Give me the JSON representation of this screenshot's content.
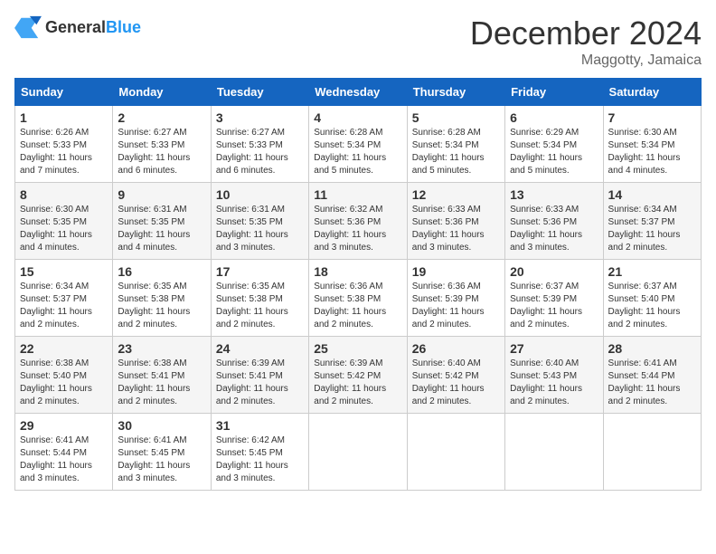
{
  "header": {
    "logo_general": "General",
    "logo_blue": "Blue",
    "month": "December 2024",
    "location": "Maggotty, Jamaica"
  },
  "weekdays": [
    "Sunday",
    "Monday",
    "Tuesday",
    "Wednesday",
    "Thursday",
    "Friday",
    "Saturday"
  ],
  "weeks": [
    [
      {
        "day": "1",
        "sunrise": "6:26 AM",
        "sunset": "5:33 PM",
        "daylight": "11 hours and 7 minutes."
      },
      {
        "day": "2",
        "sunrise": "6:27 AM",
        "sunset": "5:33 PM",
        "daylight": "11 hours and 6 minutes."
      },
      {
        "day": "3",
        "sunrise": "6:27 AM",
        "sunset": "5:33 PM",
        "daylight": "11 hours and 6 minutes."
      },
      {
        "day": "4",
        "sunrise": "6:28 AM",
        "sunset": "5:34 PM",
        "daylight": "11 hours and 5 minutes."
      },
      {
        "day": "5",
        "sunrise": "6:28 AM",
        "sunset": "5:34 PM",
        "daylight": "11 hours and 5 minutes."
      },
      {
        "day": "6",
        "sunrise": "6:29 AM",
        "sunset": "5:34 PM",
        "daylight": "11 hours and 5 minutes."
      },
      {
        "day": "7",
        "sunrise": "6:30 AM",
        "sunset": "5:34 PM",
        "daylight": "11 hours and 4 minutes."
      }
    ],
    [
      {
        "day": "8",
        "sunrise": "6:30 AM",
        "sunset": "5:35 PM",
        "daylight": "11 hours and 4 minutes."
      },
      {
        "day": "9",
        "sunrise": "6:31 AM",
        "sunset": "5:35 PM",
        "daylight": "11 hours and 4 minutes."
      },
      {
        "day": "10",
        "sunrise": "6:31 AM",
        "sunset": "5:35 PM",
        "daylight": "11 hours and 3 minutes."
      },
      {
        "day": "11",
        "sunrise": "6:32 AM",
        "sunset": "5:36 PM",
        "daylight": "11 hours and 3 minutes."
      },
      {
        "day": "12",
        "sunrise": "6:33 AM",
        "sunset": "5:36 PM",
        "daylight": "11 hours and 3 minutes."
      },
      {
        "day": "13",
        "sunrise": "6:33 AM",
        "sunset": "5:36 PM",
        "daylight": "11 hours and 3 minutes."
      },
      {
        "day": "14",
        "sunrise": "6:34 AM",
        "sunset": "5:37 PM",
        "daylight": "11 hours and 2 minutes."
      }
    ],
    [
      {
        "day": "15",
        "sunrise": "6:34 AM",
        "sunset": "5:37 PM",
        "daylight": "11 hours and 2 minutes."
      },
      {
        "day": "16",
        "sunrise": "6:35 AM",
        "sunset": "5:38 PM",
        "daylight": "11 hours and 2 minutes."
      },
      {
        "day": "17",
        "sunrise": "6:35 AM",
        "sunset": "5:38 PM",
        "daylight": "11 hours and 2 minutes."
      },
      {
        "day": "18",
        "sunrise": "6:36 AM",
        "sunset": "5:38 PM",
        "daylight": "11 hours and 2 minutes."
      },
      {
        "day": "19",
        "sunrise": "6:36 AM",
        "sunset": "5:39 PM",
        "daylight": "11 hours and 2 minutes."
      },
      {
        "day": "20",
        "sunrise": "6:37 AM",
        "sunset": "5:39 PM",
        "daylight": "11 hours and 2 minutes."
      },
      {
        "day": "21",
        "sunrise": "6:37 AM",
        "sunset": "5:40 PM",
        "daylight": "11 hours and 2 minutes."
      }
    ],
    [
      {
        "day": "22",
        "sunrise": "6:38 AM",
        "sunset": "5:40 PM",
        "daylight": "11 hours and 2 minutes."
      },
      {
        "day": "23",
        "sunrise": "6:38 AM",
        "sunset": "5:41 PM",
        "daylight": "11 hours and 2 minutes."
      },
      {
        "day": "24",
        "sunrise": "6:39 AM",
        "sunset": "5:41 PM",
        "daylight": "11 hours and 2 minutes."
      },
      {
        "day": "25",
        "sunrise": "6:39 AM",
        "sunset": "5:42 PM",
        "daylight": "11 hours and 2 minutes."
      },
      {
        "day": "26",
        "sunrise": "6:40 AM",
        "sunset": "5:42 PM",
        "daylight": "11 hours and 2 minutes."
      },
      {
        "day": "27",
        "sunrise": "6:40 AM",
        "sunset": "5:43 PM",
        "daylight": "11 hours and 2 minutes."
      },
      {
        "day": "28",
        "sunrise": "6:41 AM",
        "sunset": "5:44 PM",
        "daylight": "11 hours and 2 minutes."
      }
    ],
    [
      {
        "day": "29",
        "sunrise": "6:41 AM",
        "sunset": "5:44 PM",
        "daylight": "11 hours and 3 minutes."
      },
      {
        "day": "30",
        "sunrise": "6:41 AM",
        "sunset": "5:45 PM",
        "daylight": "11 hours and 3 minutes."
      },
      {
        "day": "31",
        "sunrise": "6:42 AM",
        "sunset": "5:45 PM",
        "daylight": "11 hours and 3 minutes."
      },
      null,
      null,
      null,
      null
    ]
  ]
}
